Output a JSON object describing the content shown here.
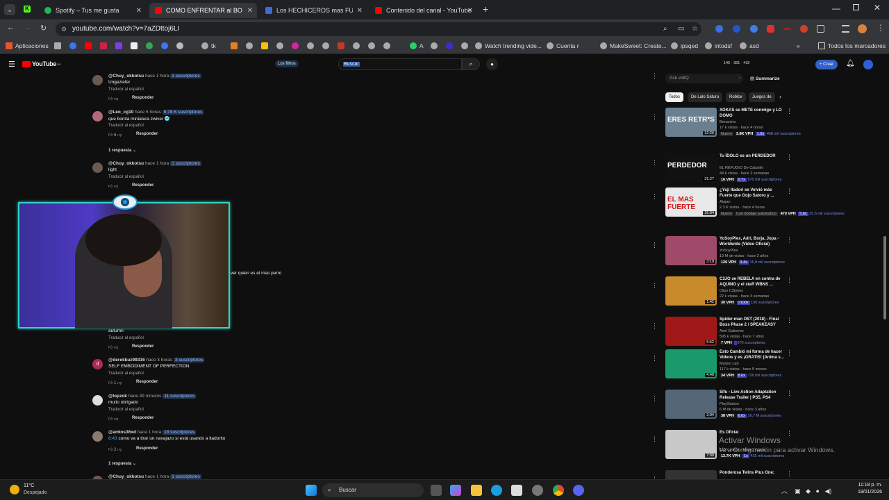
{
  "tabs": [
    {
      "label": "Spotify – Tus me gusta",
      "color": "#1db954"
    },
    {
      "label": "COMO ENFRENTAR al BOSS DE",
      "color": "#ff0000"
    },
    {
      "label": "Los HECHICEROS mas FUERTE",
      "color": "#3f6bd6"
    },
    {
      "label": "Contenido del canal - YouTube",
      "color": "#ff0000"
    }
  ],
  "url": "youtube.com/watch?v=7aZDttoj6LI",
  "bookmarks": {
    "apps": "Aplicaciones",
    "tk": "tk",
    "a": "A",
    "watch": "Watch trending vide...",
    "cuenta": "Cuenta r",
    "make": "MakeSweet: Create...",
    "ipsqed": "ipsqed",
    "intodsf": "intodsf",
    "asd": "asd",
    "todos": "Todos los marcadores"
  },
  "youtube": {
    "logo": "YouTube",
    "logo_sup": "MX",
    "filters": "Los filtros",
    "search_placeholder": "Buscar",
    "stats": [
      "145",
      "381",
      "418"
    ],
    "create": "Crear",
    "ask_placeholder": "Ask vidIQ",
    "summarize": "Summarize"
  },
  "comments": [
    {
      "author": "@Chuy_okkotsu",
      "time": "hace 1 hora",
      "subs": "1 suscriptores",
      "text": "Ungeziefer",
      "translate": "Traducir al español",
      "likes": "",
      "reply": "Responder"
    },
    {
      "author": "@Leo_cg10",
      "time": "hace 5 horas",
      "subs": "6,78 K suscriptores",
      "text": "que bonita miniatura zwiver 🥶",
      "translate": "Traducir al español",
      "likes": "6",
      "reply": "Responder",
      "replies": "1 respuesta"
    },
    {
      "author": "@Chuy_okkotsu",
      "time": "hace 1 hora",
      "subs": "1 suscriptores",
      "text": "light",
      "translate": "Traducir al español",
      "likes": "",
      "reply": "Responder"
    },
    {
      "author": "",
      "time": "",
      "subs": "",
      "text": "autumn",
      "translate": "Traducir al español",
      "likes": "",
      "reply": "Responder"
    },
    {
      "author": "@derekkuz99316",
      "time": "hace 3 horas",
      "subs": "3 suscriptores",
      "text": "SELF EMBODIMENT OF PERFECTION",
      "translate": "Traducir al español",
      "likes": "1",
      "reply": "Responder"
    },
    {
      "author": "@lopzok",
      "time": "hace 49 minutos",
      "subs": "11 suscriptores",
      "text": "muito obrigado",
      "translate": "Traducir al español",
      "likes": "",
      "reply": "Responder"
    },
    {
      "author": "@amlos36xd",
      "time": "hace 1 hora",
      "subs": "18 suscriptores",
      "timestamp": "8:43",
      "text": "como va a tirar un navajazo si está usando a itadorito",
      "translate": "",
      "likes": "2",
      "reply": "Responder",
      "replies": "1 respuesta"
    },
    {
      "author": "@Chuy_okkotsu",
      "time": "hace 1 hora",
      "subs": "1 suscriptores",
      "text": "",
      "translate": "",
      "likes": "",
      "reply": ""
    }
  ],
  "overlay_text": "ver quien es el mas perro",
  "chips": [
    "Todos",
    "De Lalo Saturu",
    "Roblox",
    "Juegos de"
  ],
  "videos": [
    {
      "title": "XOKAS se METE conmigo y LO DOMO",
      "channel": "Benamiro",
      "meta": "17 k vistas · hace 4 horas",
      "tag1": "Nuevo",
      "vph": "3.8K VPH",
      "x": "1.8x",
      "subs": "468 mil suscriptores",
      "dur": "12:26",
      "thumb": "#6a7f8f",
      "ttext": "ERES RETR*S"
    },
    {
      "title": "Tu ÍDOLO es un PERDEDOR",
      "channel": "EL REFUGIO De Caballín",
      "meta": "44 k vistas · hace 2 semanas",
      "vph": "16 VPH",
      "x": "0.7x",
      "subs": "570 mil suscriptores",
      "dur": "31:27",
      "thumb": "#111",
      "ttext": "PERDEDOR"
    },
    {
      "title": "¿Yuji Itadori se Volvió más Fuerte que Gojo Satoru y ...",
      "channel": "Atajan",
      "meta": "2.3 K vistas · hace 4 horas",
      "tag1": "Nuevo",
      "tag2": "Con doblaje automático",
      "vph": "470 VPH",
      "x": "5.6x",
      "subs": "25,5 mil suscriptores",
      "dur": "15:04",
      "thumb": "#e8e8e8",
      "ttext": "EL MAS FUERTE"
    },
    {
      "title": "YoSoyPlex, Adri, Borja, Jopa - Worldwide (Video Oficial)",
      "channel": "YoSoyPlex",
      "meta": "13 M de vistas · hace 2 años",
      "vph": "126 VPH",
      "x": "3.4x",
      "subs": "16,8 mil suscriptores",
      "dur": "3:19",
      "thumb": "#a04a6a",
      "ttext": ""
    },
    {
      "title": "C3JO se REBELA en contra de AQUINO y el staff WBNS ...",
      "channel": "Clips C3jones",
      "meta": "22 k vistas · hace 3 semanas",
      "vph": "30 VPH",
      "x": ">100x",
      "subs": "100 suscriptores",
      "dur": "1:42",
      "thumb": "#c88a2a",
      "ttext": ""
    },
    {
      "title": "Spider-man OST (2018) - Final Boss Phase 2 / SPEAKEASY",
      "channel": "Axel Gutierrez",
      "meta": "595 k vistas · hace 7 años",
      "vph": "7 VPH",
      "x": "",
      "subs": "670 suscriptores",
      "dur": "5:52",
      "thumb": "#a01818",
      "ttext": ""
    },
    {
      "title": "Esto Cambió mi forma de hacer Videos y es ¡GRATIS! (Anima s...",
      "channel": "Mostro Lab",
      "meta": "117 k vistas · hace 5 meses",
      "vph": "34 VPH",
      "x": "8.6x",
      "subs": "726 mil suscriptores",
      "dur": "4:40",
      "thumb": "#1a9a6a",
      "ttext": ""
    },
    {
      "title": "Sifu - Live Action Adaptation Release Trailer | PS5, PS4",
      "channel": "PlayStation",
      "meta": "6 M de vistas · hace 3 años",
      "vph": "38 VPH",
      "x": "6.6x",
      "subs": "16,7 M suscriptores",
      "dur": "3:04",
      "thumb": "#556677",
      "ttext": ""
    },
    {
      "title": "Es Oficial",
      "channel": "",
      "meta": "113 k vistas · hace 3 horas",
      "vph": "13.7K VPH",
      "x": "1x",
      "subs": "425 mil suscriptores",
      "dur": "7:00",
      "thumb": "#c8c8c8",
      "ttext": ""
    },
    {
      "title": "Ponderosa Twins Plus One;",
      "channel": "",
      "meta": "",
      "vph": "",
      "x": "",
      "subs": "",
      "dur": "",
      "thumb": "#333",
      "ttext": ""
    }
  ],
  "windows_watermark": {
    "line1": "Activar Windows",
    "line2": "Ve a Configuración para activar Windows."
  },
  "taskbar": {
    "temp": "11°C",
    "weather": "Despejado",
    "search": "Buscar",
    "time": "11:18 p. m.",
    "date": "18/01/2026"
  }
}
